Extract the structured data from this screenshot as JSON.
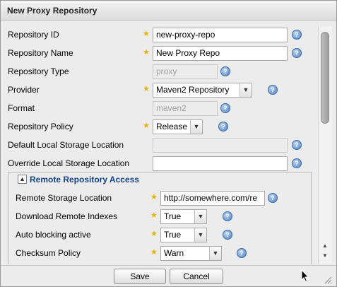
{
  "panel": {
    "title": "New Proxy Repository"
  },
  "fields": {
    "repo_id": {
      "label": "Repository ID",
      "value": "new-proxy-repo"
    },
    "repo_name": {
      "label": "Repository Name",
      "value": "New Proxy Repo"
    },
    "repo_type": {
      "label": "Repository Type",
      "value": "proxy"
    },
    "provider": {
      "label": "Provider",
      "value": "Maven2 Repository"
    },
    "format": {
      "label": "Format",
      "value": "maven2"
    },
    "policy": {
      "label": "Repository Policy",
      "value": "Release"
    },
    "default_storage": {
      "label": "Default Local Storage Location",
      "value": ""
    },
    "override_storage": {
      "label": "Override Local Storage Location",
      "value": ""
    }
  },
  "remote": {
    "legend": "Remote Repository Access",
    "storage_location": {
      "label": "Remote Storage Location",
      "value": "http://somewhere.com/re"
    },
    "download_indexes": {
      "label": "Download Remote Indexes",
      "value": "True"
    },
    "auto_blocking": {
      "label": "Auto blocking active",
      "value": "True"
    },
    "checksum": {
      "label": "Checksum Policy",
      "value": "Warn"
    }
  },
  "footer": {
    "save_label": "Save",
    "cancel_label": "Cancel"
  },
  "icons": {
    "required": "required-star-icon",
    "help": "help-icon"
  },
  "colors": {
    "required": "#e8b100",
    "help": "#4f82c4",
    "legend": "#15428b"
  }
}
